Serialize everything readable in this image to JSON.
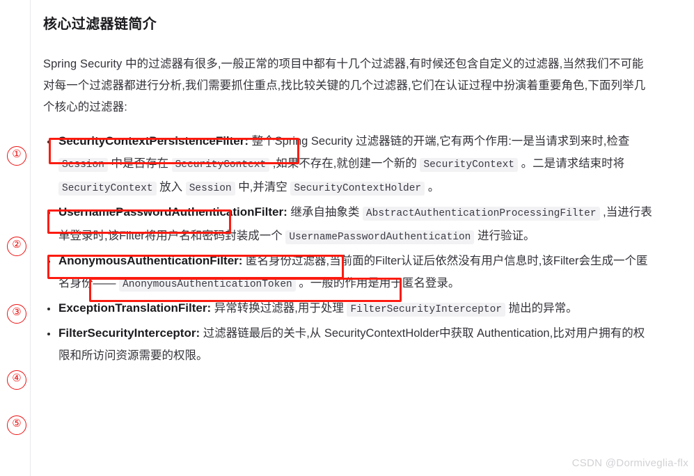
{
  "page": {
    "title": "核心过滤器链简介",
    "intro": "Spring Security 中的过滤器有很多,一般正常的项目中都有十几个过滤器,有时候还包含自定义的过滤器,当然我们不可能对每一个过滤器都进行分析,我们需要抓住重点,找比较关键的几个过滤器,它们在认证过程中扮演着重要角色,下面列举几个核心的过滤器:",
    "watermark": "CSDN @Dormiveglia-flx",
    "accent_color": "#fc1b10",
    "marker_color": "#ee1111",
    "code_bg": "#f2f2f4"
  },
  "markers": [
    {
      "label": "①"
    },
    {
      "label": "②"
    },
    {
      "label": "③"
    },
    {
      "label": "④"
    },
    {
      "label": "⑤"
    }
  ],
  "filters": [
    {
      "name": "SecurityContextPersistenceFilter",
      "colon": ":",
      "t1": " 整个Spring Security 过滤器链的开端,它有两个作用:一是当请求到来时,检查 ",
      "c1": "Session",
      "t2": " 中是否存在 ",
      "c2": "SecurityContext",
      "t3": " ,如果不存在,就创建一个新的 ",
      "c3": "SecurityContext",
      "t4": " 。二是请求结束时将 ",
      "c4": "SecurityContext",
      "t5": " 放入 ",
      "c5": "Session",
      "t6": " 中,并清空 ",
      "c6": "SecurityContextHolder",
      "t7": " 。"
    },
    {
      "name": "UsernamePasswordAuthenticationFilter",
      "colon": ":",
      "t1": "  继承自抽象类 ",
      "c1": "AbstractAuthenticationProcessingFilter",
      "t2": " ,当进行表单登录时,该Filter将用户名和密码封装成一个 ",
      "c2": "UsernamePasswordAuthentication",
      "t3": " 进行验证。"
    },
    {
      "name": "AnonymousAuthenticationFilter",
      "colon": ":",
      "t1": " 匿名身份过滤器,当前面的Filter认证后依然没有用户信息时,该Filter会生成一个匿名身份—— ",
      "c1": "AnonymousAuthenticationToken",
      "t2": " 。一般的作用是用于匿名登录。"
    },
    {
      "name": "ExceptionTranslationFilter",
      "colon": ":",
      "t1": "  异常转换过滤器,用于处理 ",
      "c1": "FilterSecurityInterceptor",
      "t2": " 抛出的异常。"
    },
    {
      "name": "FilterSecurityInterceptor",
      "colon": ":",
      "t1": "  过滤器链最后的关卡,从 SecurityContextHolder中获取 Authentication,比对用户拥有的权限和所访问资源需要的权限。"
    }
  ],
  "highlights": [
    {
      "name": "highlight-securitycontextpersistencefilter"
    },
    {
      "name": "highlight-securitycontextholder"
    },
    {
      "name": "highlight-abstractauthenticationprocessingfilter"
    },
    {
      "name": "highlight-usernamepasswordauthentication"
    }
  ]
}
